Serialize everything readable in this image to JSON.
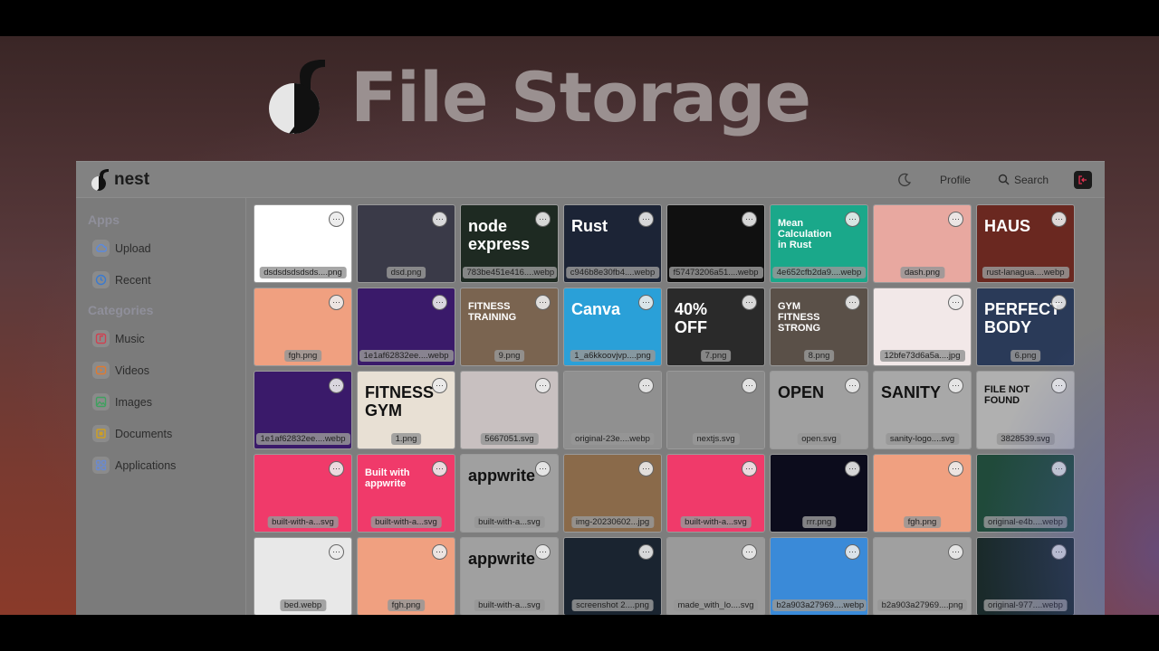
{
  "headline": {
    "title": "File Storage"
  },
  "app": {
    "brand": "nest",
    "topbar": {
      "profile_label": "Profile",
      "search_label": "Search"
    },
    "sidebar": {
      "apps_title": "Apps",
      "apps": [
        {
          "label": "Upload",
          "icon": "cloud-upload-icon",
          "color": "#5a8ae0"
        },
        {
          "label": "Recent",
          "icon": "clock-icon",
          "color": "#3a7ad0"
        }
      ],
      "categories_title": "Categories",
      "categories": [
        {
          "label": "Music",
          "icon": "music-icon",
          "color": "#d04050"
        },
        {
          "label": "Videos",
          "icon": "video-icon",
          "color": "#e07a30"
        },
        {
          "label": "Images",
          "icon": "image-icon",
          "color": "#40a060"
        },
        {
          "label": "Documents",
          "icon": "document-icon",
          "color": "#d0a020"
        },
        {
          "label": "Applications",
          "icon": "app-icon",
          "color": "#6a8ad0"
        }
      ]
    },
    "files": [
      {
        "name": "dsdsdsdsdsds....png",
        "bg": "#ffffff"
      },
      {
        "name": "dsd.png",
        "bg": "#3a3a48"
      },
      {
        "name": "783be451e416....webp",
        "bg": "#1e2a22",
        "text": "node express"
      },
      {
        "name": "c946b8e30fb4....webp",
        "bg": "#1c2436",
        "text": "Rust"
      },
      {
        "name": "f57473206a51....webp",
        "bg": "#101010"
      },
      {
        "name": "4e652cfb2da9....webp",
        "bg": "#1aa88a",
        "text": "Mean Calculation in Rust"
      },
      {
        "name": "dash.png",
        "bg": "#e8a8a0"
      },
      {
        "name": "rust-lanagua....webp",
        "bg": "#6a2820",
        "text": "HAUS"
      },
      {
        "name": "fgh.png",
        "bg": "#f0a080"
      },
      {
        "name": "1e1af62832ee....webp",
        "bg": "#3a1a6a"
      },
      {
        "name": "9.png",
        "bg": "#7a6450",
        "text": "FITNESS TRAINING"
      },
      {
        "name": "1_a6kkoovjvp....png",
        "bg": "#2aa0d8",
        "text": "Canva"
      },
      {
        "name": "7.png",
        "bg": "#2a2a2a",
        "text": "40% OFF"
      },
      {
        "name": "8.png",
        "bg": "#5a5048",
        "text": "GYM FITNESS STRONG"
      },
      {
        "name": "12bfe73d6a5a....jpg",
        "bg": "#f2e8e8"
      },
      {
        "name": "6.png",
        "bg": "#2a3a58",
        "text": "PERFECT BODY"
      },
      {
        "name": "1e1af62832ee....webp",
        "bg": "#3a1a6a"
      },
      {
        "name": "1.png",
        "bg": "#e8e0d4",
        "text": "FITNESS GYM"
      },
      {
        "name": "5667051.svg",
        "bg": "#c8c0c0"
      },
      {
        "name": "original-23e....webp",
        "bg": "#909090"
      },
      {
        "name": "nextjs.svg",
        "bg": "#8a8a8a"
      },
      {
        "name": "open.svg",
        "bg": "#a0a0a0",
        "text": "OPEN"
      },
      {
        "name": "sanity-logo....svg",
        "bg": "#a8a8a8",
        "text": "SANITY"
      },
      {
        "name": "3828539.svg",
        "bg": "#b0b0b0",
        "text": "FILE NOT FOUND"
      },
      {
        "name": "built-with-a...svg",
        "bg": "#f03a6a"
      },
      {
        "name": "built-with-a...svg",
        "bg": "#f03a6a",
        "text": "Built with appwrite"
      },
      {
        "name": "built-with-a...svg",
        "bg": "#a0a0a0",
        "text": "appwrite"
      },
      {
        "name": "img-20230602...jpg",
        "bg": "#8a6a4a"
      },
      {
        "name": "built-with-a...svg",
        "bg": "#f03a6a"
      },
      {
        "name": "rrr.png",
        "bg": "#0c0c1c"
      },
      {
        "name": "fgh.png",
        "bg": "#f0a080"
      },
      {
        "name": "original-e4b....webp",
        "bg": "#204a3a"
      },
      {
        "name": "bed.webp",
        "bg": "#e8e8e8"
      },
      {
        "name": "fgh.png",
        "bg": "#f0a080"
      },
      {
        "name": "built-with-a...svg",
        "bg": "#a0a0a0",
        "text": "appwrite"
      },
      {
        "name": "screenshot 2....png",
        "bg": "#1a2430"
      },
      {
        "name": "made_with_lo....svg",
        "bg": "#9a9a9a"
      },
      {
        "name": "b2a903a27969....webp",
        "bg": "#3a8ad8"
      },
      {
        "name": "b2a903a27969....png",
        "bg": "#a0a0a0"
      },
      {
        "name": "original-977....webp",
        "bg": "#1a2a2a"
      }
    ]
  }
}
